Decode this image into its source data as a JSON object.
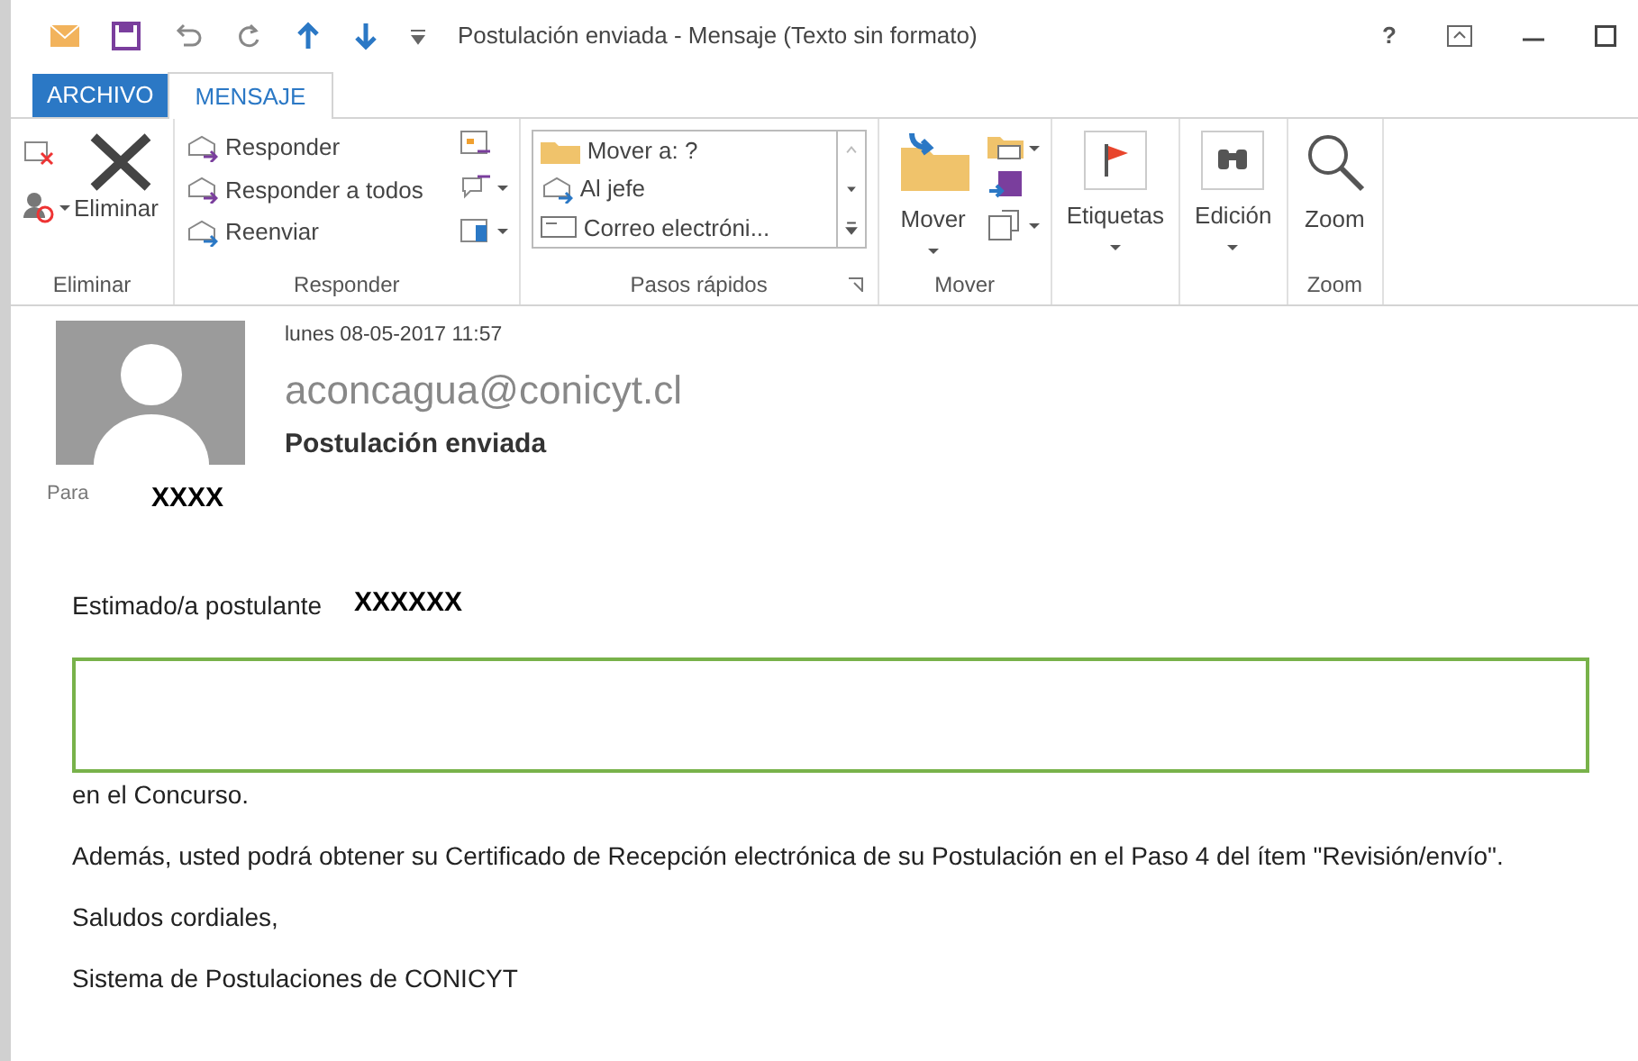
{
  "window": {
    "title": "Postulación enviada - Mensaje (Texto sin formato)",
    "help": "?"
  },
  "tabs": [
    {
      "label": "ARCHIVO",
      "kind": "file"
    },
    {
      "label": "MENSAJE",
      "kind": "tab",
      "selected": true
    }
  ],
  "ribbon": {
    "groups": [
      {
        "label": "Eliminar",
        "items": [
          {
            "kind": "large",
            "label": "Eliminar"
          }
        ]
      },
      {
        "label": "Responder",
        "items": [
          {
            "kind": "small",
            "label": "Responder"
          },
          {
            "kind": "small",
            "label": "Responder a todos"
          },
          {
            "kind": "small",
            "label": "Reenviar"
          }
        ]
      },
      {
        "label": "Pasos rápidos",
        "quick_steps": [
          "Mover a: ?",
          "Al jefe",
          "Correo electróni..."
        ]
      },
      {
        "label": "Mover",
        "items": [
          {
            "kind": "large",
            "label": "Mover"
          }
        ]
      },
      {
        "items": [
          {
            "kind": "large",
            "label": "Etiquetas"
          }
        ]
      },
      {
        "items": [
          {
            "kind": "large",
            "label": "Edición"
          }
        ]
      },
      {
        "label": "Zoom",
        "items": [
          {
            "kind": "large",
            "label": "Zoom"
          }
        ]
      }
    ]
  },
  "header": {
    "date": "lunes 08-05-2017 11:57",
    "sender": "aconcagua@conicyt.cl",
    "subject": "Postulación enviada",
    "to_label": "Para",
    "to": "XXXX"
  },
  "body": {
    "greeting": "Estimado/a postulante",
    "recipient_name": "XXXXXX",
    "paragraphs": [
      "en el Concurso.",
      "Además, usted podrá obtener su Certificado de Recepción electrónica de su Postulación en el Paso 4 del ítem \"Revisión/envío\".",
      "Saludos cordiales,",
      "Sistema de Postulaciones de CONICYT"
    ]
  }
}
